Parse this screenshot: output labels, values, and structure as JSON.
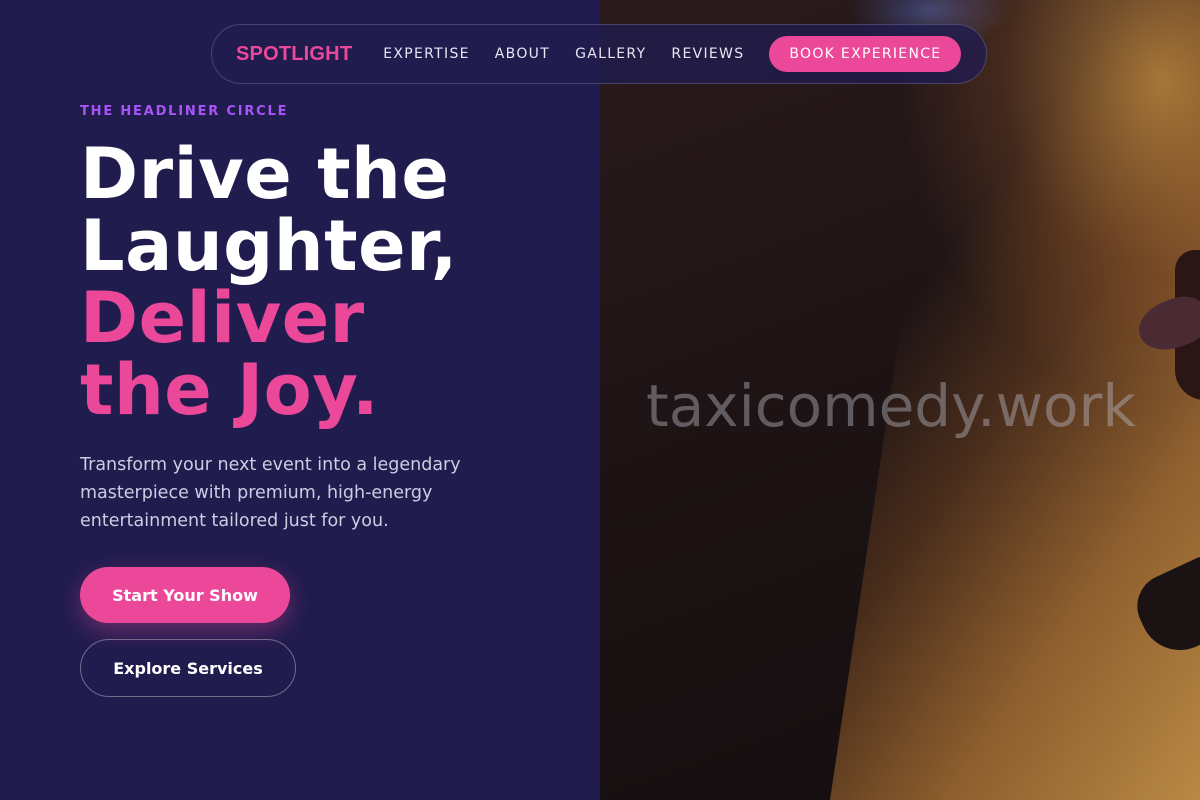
{
  "brand": {
    "logo": "SPOTLIGHT"
  },
  "nav": {
    "links": [
      "EXPERTISE",
      "ABOUT",
      "GALLERY",
      "REVIEWS"
    ],
    "cta": "BOOK EXPERIENCE"
  },
  "hero": {
    "eyebrow": "THE HEADLINER CIRCLE",
    "headline_line1": "Drive the",
    "headline_line2": "Laughter,",
    "headline_line3": "Deliver",
    "headline_line4": "the Joy.",
    "description": "Transform your next event into a legendary masterpiece with premium, high-energy entertainment tailored just for you.",
    "primary_cta": "Start Your Show",
    "secondary_cta": "Explore Services"
  },
  "image": {
    "watermark": "taxicomedy.work"
  },
  "colors": {
    "background": "#211c4e",
    "accent_pink": "#ec4899",
    "accent_purple": "#a855f7"
  }
}
